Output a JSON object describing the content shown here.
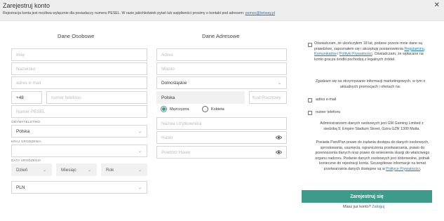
{
  "header": {
    "title": "Zarejestruj konto",
    "notice_text": "Rejestracja konta jest możliwa wyłącznie dla posiadaczy numeru PESEL. W razie jakichkolwiek pytań lub wątpliwości prosimy o kontakt pod adresem: ",
    "notice_email": "pomoc@betway.pl",
    "close_glyph": "✕"
  },
  "personal": {
    "heading": "Dane Osobowe",
    "first_name_placeholder": "Imię",
    "last_name_placeholder": "Nazwisko",
    "email_placeholder": "adres e-mail",
    "phone_prefix": "+48",
    "phone_placeholder": "numer telefonu",
    "pesel_placeholder": "Numer PESEL",
    "citizenship_label": "OBYWATELSTWO",
    "citizenship_value": "Polska",
    "birth_country_label": "KRAJ URODZENIA",
    "birth_country_value": "",
    "birth_date_label": "DATA URODZENIA",
    "day_placeholder": "Dzień",
    "month_placeholder": "Miesiąc",
    "year_placeholder": "Rok",
    "currency_value": "PLN"
  },
  "address": {
    "heading": "Dane Adresowe",
    "address_placeholder": "Adres",
    "city_placeholder": "Miasto",
    "region_value": "Dolnośląskie",
    "country_value": "Polska",
    "postal_placeholder": "Kod Pocztowy",
    "gender_male": "Mężczyzna",
    "gender_female": "Kobieta",
    "username_placeholder": "Nazwa Użytkownika",
    "password_placeholder": "Hasło",
    "password_repeat_placeholder": "Powtórz Hasło"
  },
  "consents": {
    "age_text_1": "Oświadczam, że ukończyłem 18 lat, podane przeze mnie dane są prawdziwe, zapoznałem się i akceptuję postanowienia ",
    "regulations_link": "Regulaminu",
    "sep1": ", ",
    "messages_link": "Komunikatów",
    "sep2": " i ",
    "privacy_link": "Polityki Prywatności",
    "age_text_2": ". Oświadczam, że wpłacane na konto gracza środki pochodzą z legalnych źródeł.",
    "marketing_text": "Zgadzam się na otrzymywanie informacji marketingowych, w tym o aktualnych promocjach i ofertach na:",
    "email_option": "adres e-mail",
    "phone_option": "numer telefonu",
    "admin_text": "Administratorem danych osobowych jest GM Gaming Limited z siedzibą 9, Empire Stadium Street, Gzira GZR 1300 Malta.",
    "rights_text": "Posiada Pani/Pan prawo do żądania dostępu do danych osobowych, sprostowania, usunięcia, ograniczenia przetwarzania, prawo do przenoszenia danych oraz prawo do wniesienia skargi do właściwego organu nadzoru. Podanie danych osobowych jest dobrowolne, jednak konieczne do rejestracji konta. Szczegółowe informacje na temat przetwarzania danych dostępne są w ",
    "rights_link": "Polityce Prywatności",
    "rights_end": "."
  },
  "actions": {
    "register_button": "Zarejestruj się",
    "have_account_text": "Masz już konto? ",
    "login_link": "Zaloguj"
  },
  "colors": {
    "accent": "#3d9b8c",
    "link": "#1a7bbf"
  }
}
